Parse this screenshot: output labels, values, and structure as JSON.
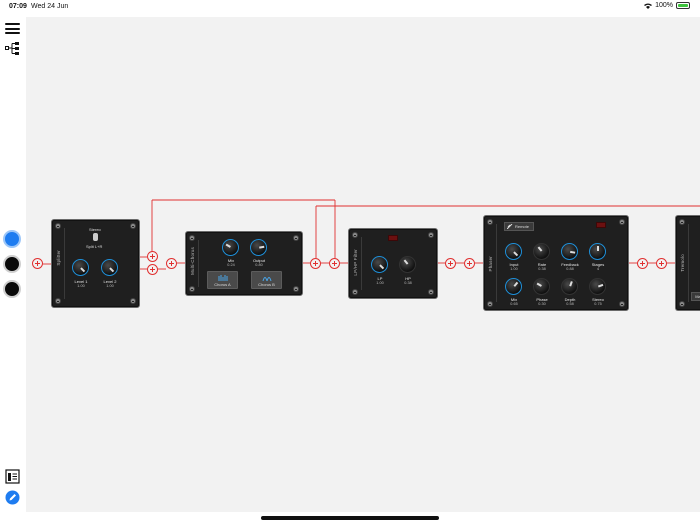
{
  "status_bar": {
    "time": "07:09",
    "date": "Wed 24 Jun",
    "battery": "100%"
  },
  "colors": {
    "accent": "#1e7cf0",
    "wire": "#e03030",
    "canvas": "#f2f2f2",
    "module": "#1f1f1f"
  },
  "sidebar": {
    "menu_icon": "hamburger-icon",
    "tree_icon": "tree-structure-icon",
    "bottom_icons": [
      "preset-list-icon",
      "edit-pencil-icon"
    ]
  },
  "modules": {
    "splitter": {
      "label": "Splitter",
      "mode": "Stereo",
      "switch_label": "Split L+R",
      "knobs": [
        {
          "name": "Level 1",
          "value": "1.00"
        },
        {
          "name": "Level 2",
          "value": "1.00"
        }
      ]
    },
    "multichorus": {
      "label": "Multi-Chorus",
      "knobs": [
        {
          "name": "Mix",
          "value": "0.24"
        },
        {
          "name": "Output",
          "value": "0.80"
        }
      ],
      "buttons": [
        "Chorus A",
        "Chorus B"
      ]
    },
    "lphp": {
      "label": "LP/HP Filter",
      "knobs": [
        {
          "name": "LP",
          "value": "1.00"
        },
        {
          "name": "HP",
          "value": "0.38"
        }
      ]
    },
    "phaser": {
      "label": "Phaser",
      "remote_label": "Remote",
      "knobs_top": [
        {
          "name": "Input",
          "value": "1.00"
        },
        {
          "name": "Rate",
          "value": "0.38"
        },
        {
          "name": "Feedback",
          "value": "0.88"
        },
        {
          "name": "Stages",
          "value": "4"
        }
      ],
      "knobs_bottom": [
        {
          "name": "Mix",
          "value": "0.65"
        },
        {
          "name": "Phase",
          "value": "0.30"
        },
        {
          "name": "Depth",
          "value": "0.58"
        },
        {
          "name": "Stereo",
          "value": "0.75"
        }
      ]
    },
    "tremolo": {
      "label": "Tremolo",
      "button_label": "Ma"
    }
  }
}
